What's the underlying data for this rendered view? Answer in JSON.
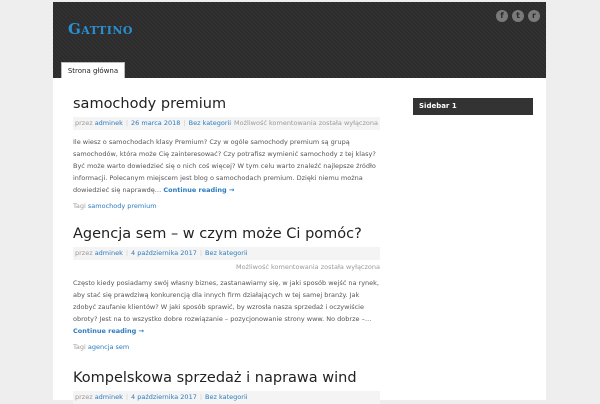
{
  "header": {
    "site_title": "Gattino",
    "social": [
      {
        "icon": "facebook-icon",
        "glyph": "f"
      },
      {
        "icon": "twitter-icon",
        "glyph": "t"
      },
      {
        "icon": "rss-icon",
        "glyph": "r"
      }
    ]
  },
  "nav": {
    "home_label": "Strona główna"
  },
  "sidebar": {
    "title": "Sidebar 1"
  },
  "posts": [
    {
      "title": "samochody premium",
      "by_label": "przez",
      "author": "adminek",
      "date": "26 marca 2018",
      "category": "Bez kategorii",
      "comments": "Możliwość komentowania została wyłączona",
      "excerpt": "Ile wiesz o samochodach klasy Premium? Czy w ogóle samochody premium są grupą samochodów, która może Cię zainteresować? Czy potrafisz wymienić samochody z tej klasy? Być może warto dowiedzieć się o nich coś więcej? W tym celu warto znaleźć najlepsze źródło informacji. Polecanym miejscem jest blog o samochodach premium. Dzięki niemu można dowiedzieć się naprawdę…",
      "more": "Continue reading →",
      "tags_label": "Tagi",
      "tag": "samochody premium"
    },
    {
      "title": "Agencja sem – w czym może Ci pomóc?",
      "by_label": "przez",
      "author": "adminek",
      "date": "4 października 2017",
      "category": "Bez kategorii",
      "comments": "Możliwość komentowania została wyłączona",
      "excerpt": "Często kiedy posiadamy swój własny biznes, zastanawiamy się, w jaki sposób wejść na rynek, aby stać się prawdziwą konkurencją dla innych firm działających w tej samej branży. Jak zdobyć zaufanie klientów? W jaki sposób sprawić, by wzrosła nasza sprzedaż i oczywiście obroty? Jest na to wszystko dobre rozwiązanie – pozycjonowanie strony www. No dobrze –…",
      "more": "Continue reading →",
      "tags_label": "Tagi",
      "tag": "agencja sem"
    },
    {
      "title": "Kompelskowa sprzedaż i naprawa wind",
      "by_label": "przez",
      "author": "adminek",
      "date": "4 października 2017",
      "category": "Bez kategorii"
    }
  ]
}
